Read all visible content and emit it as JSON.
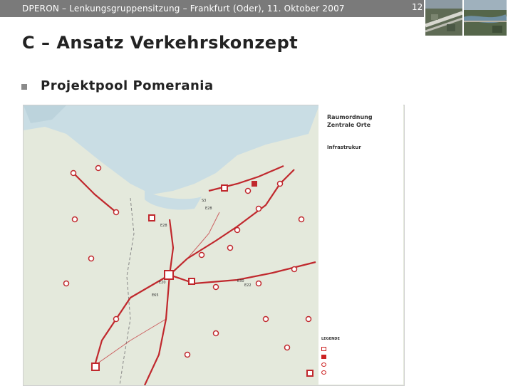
{
  "header": {
    "text": "DPERON – Lenkungsgruppensitzung – Frankfurt (Oder), 11. Oktober 2007",
    "page_number": "12",
    "photo_icons": [
      "aerial-photo-highway-icon",
      "aerial-photo-river-icon"
    ]
  },
  "slide": {
    "title": "C – Ansatz Verkehrskonzept",
    "bullet": "Projektpool Pomerania"
  },
  "map": {
    "legend": {
      "title_line1": "Raumordnung",
      "title_line2": "Zentrale Orte",
      "infra": "Infrastrukur",
      "heading": "LEGENDE"
    },
    "road_labels": [
      "E28",
      "E28",
      "E65",
      "E20",
      "E30",
      "E22",
      "S3"
    ],
    "colors": {
      "road": "#c0282d",
      "land": "#e4e9dc",
      "water": "#c9dde4"
    }
  }
}
